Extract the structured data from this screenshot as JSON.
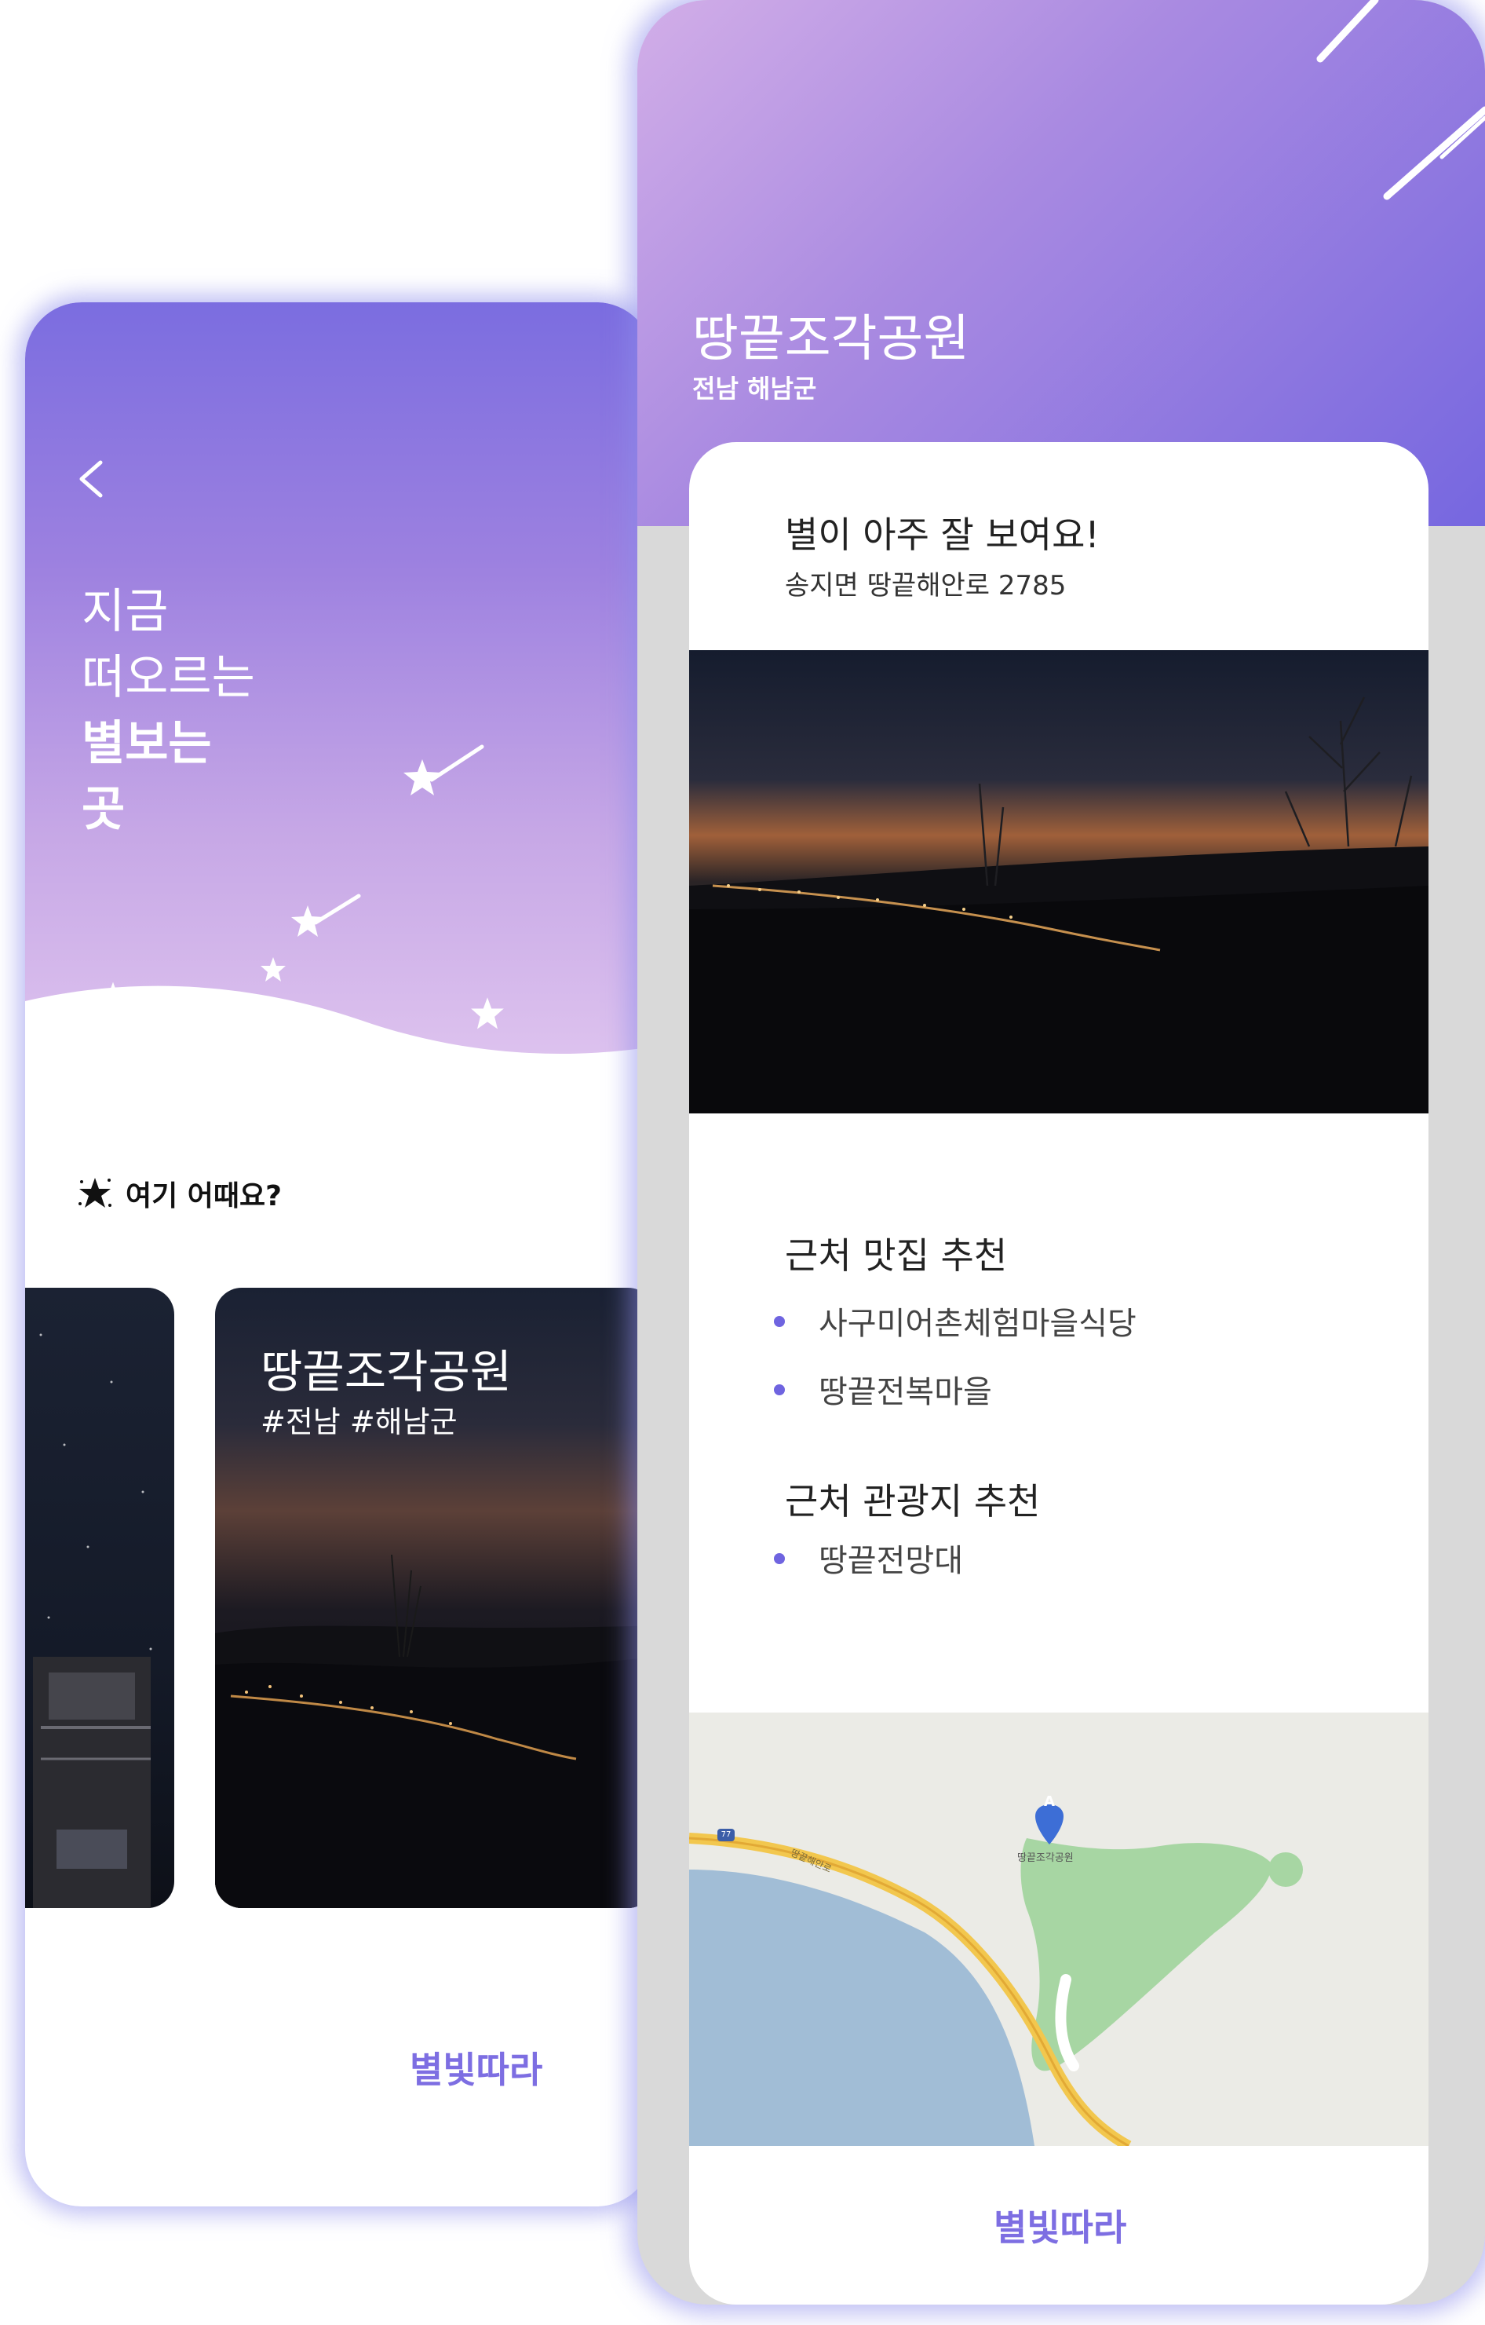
{
  "left_screen": {
    "hero_lines": [
      "지금",
      "떠오르는",
      "별보는",
      "곳"
    ],
    "section_label": "여기 어때요?",
    "card": {
      "title": "땅끝조각공원",
      "tags": "#전남 #해남군"
    },
    "brand": "별빛따라"
  },
  "right_screen": {
    "title": "땅끝조각공원",
    "region": "전남 해남군",
    "headline": "별이 아주 잘 보여요!",
    "address": "송지면 땅끝해안로 2785",
    "restaurants_title": "근처 맛집 추천",
    "restaurants": [
      "사구미어촌체험마을식당",
      "땅끝전복마을"
    ],
    "attractions_title": "근처 관광지 추천",
    "attractions": [
      "땅끝전망대"
    ],
    "map": {
      "marker": "A",
      "marker_label": "땅끝조각공원",
      "road_label": "땅끝해안로",
      "route_number": "77"
    },
    "brand": "별빛따라"
  },
  "colors": {
    "accent": "#7d6ee2",
    "gradient_top": "#7b6de0",
    "gradient_bottom": "#ddc2ee",
    "bullet": "#6f64e0"
  }
}
